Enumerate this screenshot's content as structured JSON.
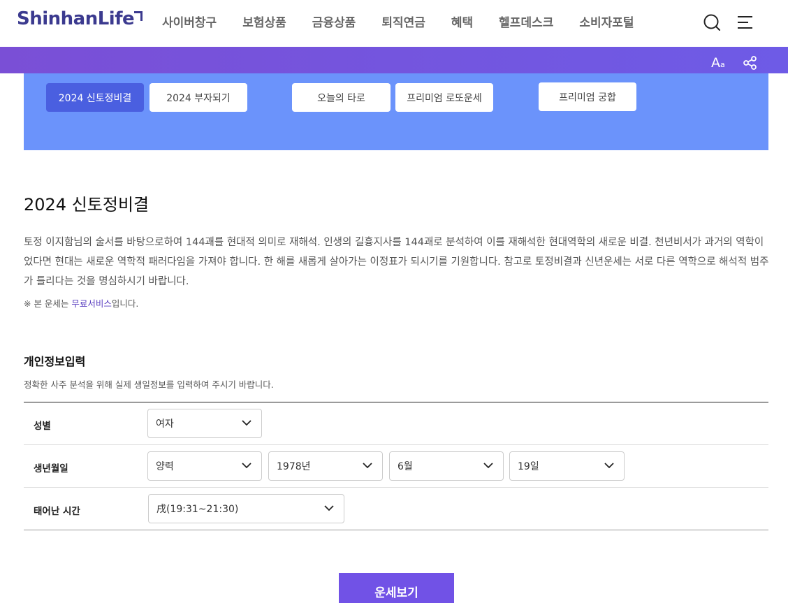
{
  "header": {
    "logo": "ShinhanLife",
    "nav": [
      "사이버창구",
      "보험상품",
      "금융상품",
      "퇴직연금",
      "혜택",
      "헬프데스크",
      "소비자포털"
    ],
    "icons": {
      "search": "search-icon",
      "menu": "hamburger-menu-icon"
    }
  },
  "subbar": {
    "font_size_label": "A",
    "font_size_small": "a",
    "share_icon": "share-icon"
  },
  "tabs": [
    {
      "label": "2024 신토정비결",
      "active": true
    },
    {
      "label": "2024 부자되기",
      "active": false
    },
    {
      "label": "오늘의 타로",
      "active": false
    },
    {
      "label": "프리미엄 로또운세",
      "active": false
    },
    {
      "label": "프리미엄 궁합",
      "active": false
    }
  ],
  "main": {
    "title": "2024 신토정비결",
    "description": "토정 이지함님의 술서를 바탕으로하여 144괘를 현대적 의미로 재해석. 인생의 길흉지사를 144괘로 분석하여 이를 재해석한 현대역학의 새로운 비결. 천년비서가 과거의 역학이었다면 현대는 새로운 역학적 패러다임을 가져야 합니다. 한 해를 새롭게 살아가는 이정표가 되시기를 기원합니다. 참고로 토정비결과 신년운세는 서로 다른 역학으로 해석적 범주가 틀리다는 것을 명심하시기 바랍니다.",
    "note_prefix": "※ 본 운세는 ",
    "note_link": "무료서비스",
    "note_suffix": "입니다."
  },
  "form": {
    "title": "개인정보입력",
    "description": "정확한 사주 분석을 위해 실제 생일정보를 입력하여 주시기 바랍니다.",
    "gender_label": "성별",
    "gender_value": "여자",
    "birth_label": "생년월일",
    "calendar_value": "양력",
    "year_value": "1978년",
    "month_value": "6월",
    "day_value": "19일",
    "time_label": "태어난 시간",
    "time_value": "戌(19:31~21:30)",
    "submit_label": "운세보기"
  },
  "colors": {
    "brand": "#3b3a8f",
    "purple_bar": "#7152e6",
    "tab_area": "#6b93fb",
    "tab_active": "#4a5fe0",
    "submit": "#7152e6"
  }
}
